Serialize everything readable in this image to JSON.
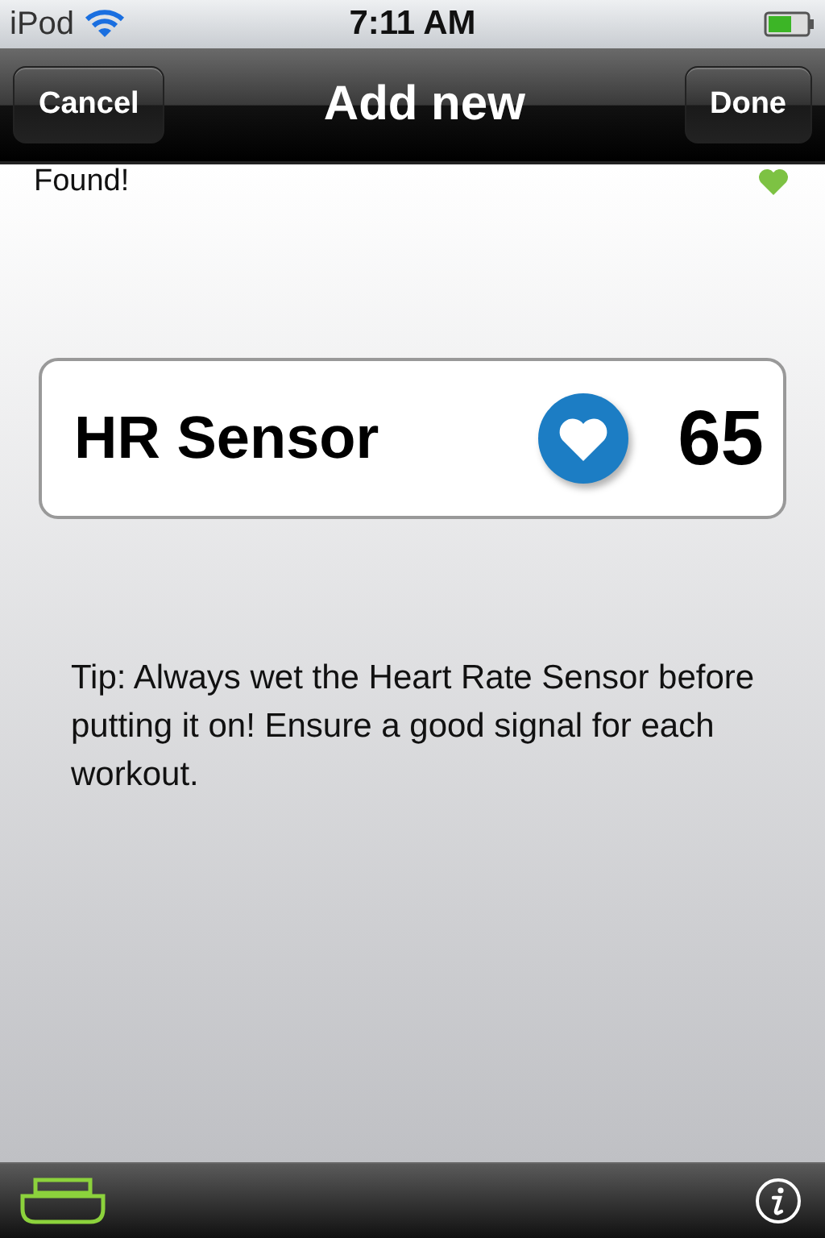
{
  "status_bar": {
    "carrier": "iPod",
    "time": "7:11 AM"
  },
  "nav_bar": {
    "title": "Add new",
    "left_button": "Cancel",
    "right_button": "Done"
  },
  "status_message": "Found!",
  "sensor": {
    "name": "HR Sensor",
    "reading": "65"
  },
  "tip": "Tip: Always wet the Heart Rate Sensor before putting it on! Ensure a good signal for each workout."
}
